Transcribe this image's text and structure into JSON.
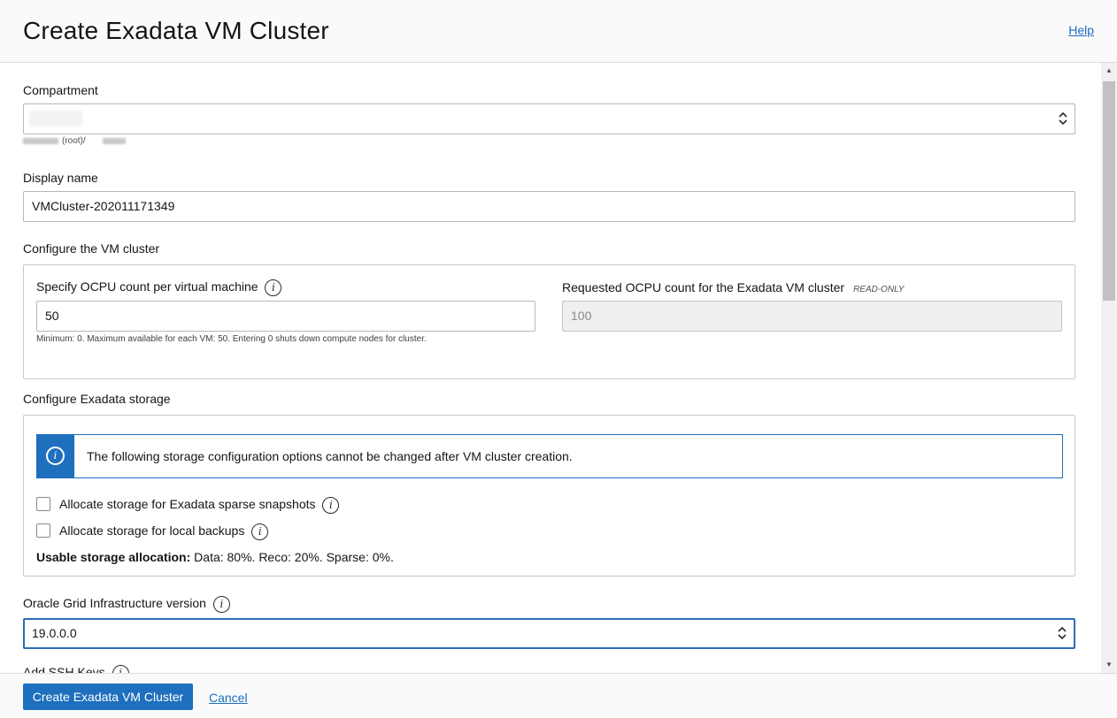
{
  "header": {
    "title": "Create Exadata VM Cluster",
    "help_link": "Help"
  },
  "compartment": {
    "label": "Compartment",
    "value": "",
    "path_suffix": "(root)/"
  },
  "display_name": {
    "label": "Display name",
    "value": "VMCluster-202011171349"
  },
  "vm_cluster": {
    "section_label": "Configure the VM cluster",
    "ocpu_label": "Specify OCPU count per virtual machine",
    "ocpu_value": "50",
    "ocpu_note": "Minimum: 0. Maximum available for each VM: 50. Entering 0 shuts down compute nodes for cluster.",
    "requested_label": "Requested OCPU count for the Exadata VM cluster",
    "requested_badge": "READ-ONLY",
    "requested_value": "100"
  },
  "storage": {
    "section_label": "Configure Exadata storage",
    "banner_text": "The following storage configuration options cannot be changed after VM cluster creation.",
    "sparse_label": "Allocate storage for Exadata sparse snapshots",
    "backups_label": "Allocate storage for local backups",
    "usable_label": "Usable storage allocation:",
    "usable_value": "Data: 80%. Reco: 20%. Sparse: 0%."
  },
  "grid": {
    "label": "Oracle Grid Infrastructure version",
    "value": "19.0.0.0"
  },
  "ssh": {
    "label": "Add SSH Keys"
  },
  "footer": {
    "create_button": "Create Exadata VM Cluster",
    "cancel_link": "Cancel"
  },
  "colors": {
    "accent": "#1e6fbd",
    "link": "#1a6fbf"
  },
  "icons": {
    "info": "info-icon",
    "select": "select-arrows-icon"
  }
}
